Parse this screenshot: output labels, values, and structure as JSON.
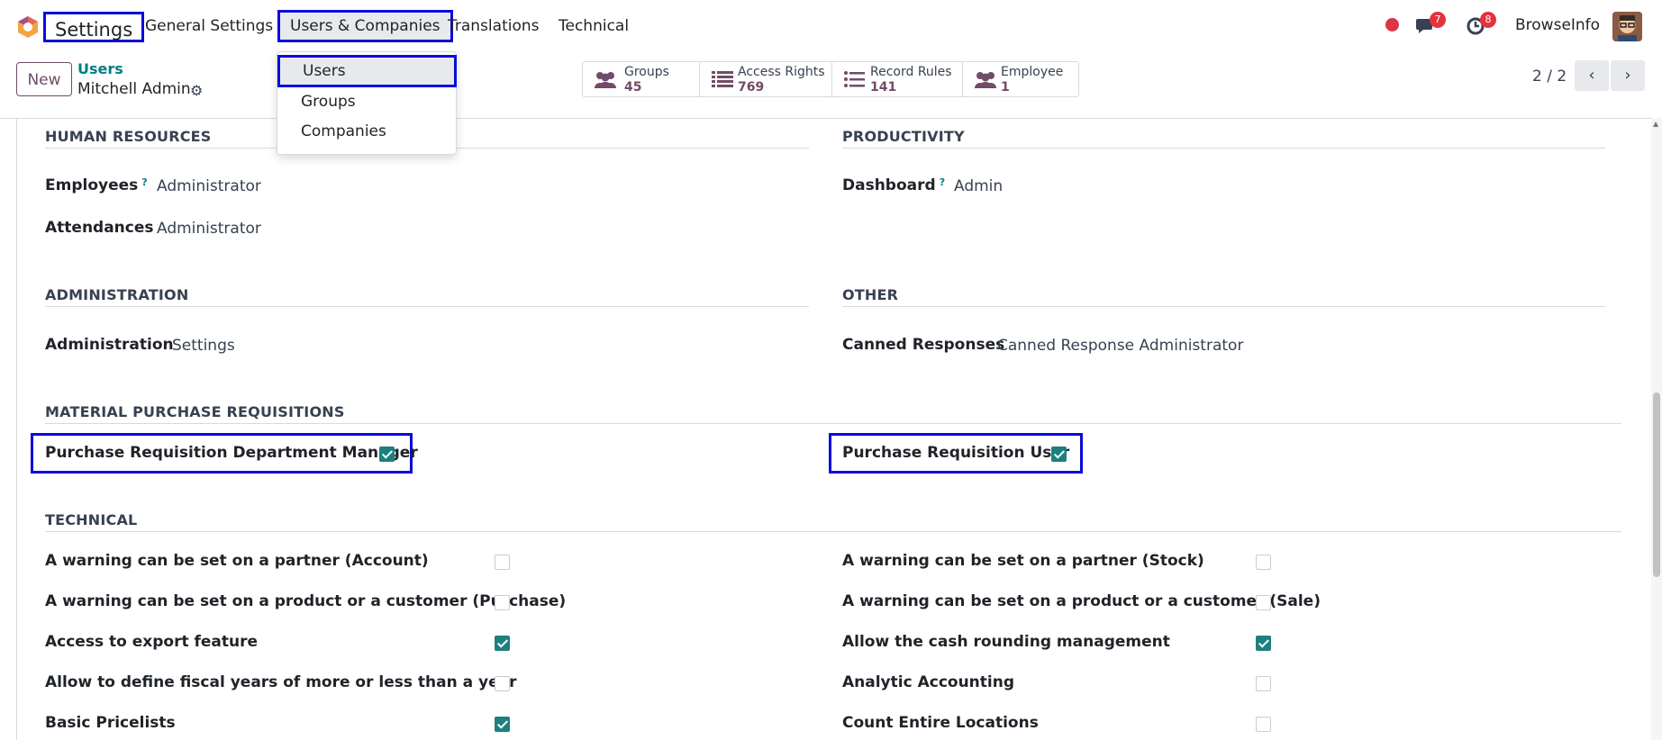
{
  "navbar": {
    "app_title": "Settings",
    "menu": [
      "General Settings",
      "Users & Companies",
      "Translations",
      "Technical"
    ],
    "active_menu": "Users & Companies",
    "messages_badge": "7",
    "activities_badge": "8",
    "company": "BrowseInfo"
  },
  "dropdown": {
    "items": [
      "Users",
      "Groups",
      "Companies"
    ]
  },
  "control_panel": {
    "new_label": "New",
    "breadcrumb_parent": "Users",
    "breadcrumb_current": "Mitchell Admin",
    "stats": [
      {
        "label": "Groups",
        "value": "45"
      },
      {
        "label": "Access Rights",
        "value": "769"
      },
      {
        "label": "Record Rules",
        "value": "141"
      },
      {
        "label": "Employee",
        "value": "1"
      }
    ],
    "pager": "2 / 2"
  },
  "sections": {
    "human_resources": {
      "title": "HUMAN RESOURCES",
      "fields": [
        {
          "label": "Employees",
          "value": "Administrator",
          "help": "?"
        },
        {
          "label": "Attendances",
          "value": "Administrator"
        }
      ]
    },
    "productivity": {
      "title": "PRODUCTIVITY",
      "fields": [
        {
          "label": "Dashboard",
          "value": "Admin",
          "help": "?"
        }
      ]
    },
    "administration": {
      "title": "ADMINISTRATION",
      "fields": [
        {
          "label": "Administration",
          "value": "Settings"
        }
      ]
    },
    "other": {
      "title": "OTHER",
      "fields": [
        {
          "label": "Canned Responses",
          "value": "Canned Response Administrator"
        }
      ]
    },
    "material_purchase": {
      "title": "MATERIAL PURCHASE REQUISITIONS",
      "fields": [
        {
          "label": "Purchase Requisition Department Manager",
          "checked": true
        },
        {
          "label": "Purchase Requisition User",
          "checked": true
        }
      ]
    },
    "technical": {
      "title": "TECHNICAL",
      "left": [
        {
          "label": "A warning can be set on a partner (Account)",
          "checked": false
        },
        {
          "label": "A warning can be set on a product or a customer (Purchase)",
          "checked": false
        },
        {
          "label": "Access to export feature",
          "checked": true
        },
        {
          "label": "Allow to define fiscal years of more or less than a year",
          "checked": false
        },
        {
          "label": "Basic Pricelists",
          "checked": true
        }
      ],
      "right": [
        {
          "label": "A warning can be set on a partner (Stock)",
          "checked": false
        },
        {
          "label": "A warning can be set on a product or a customer (Sale)",
          "checked": false
        },
        {
          "label": "Allow the cash rounding management",
          "checked": true
        },
        {
          "label": "Analytic Accounting",
          "checked": false
        },
        {
          "label": "Count Entire Locations",
          "checked": false
        }
      ]
    }
  },
  "colors": {
    "brand": "#714b67",
    "accent": "#017e84",
    "checkbox_checked": "#1e7f80",
    "highlight_box": "#0a0adb",
    "badge": "#e2343e"
  }
}
